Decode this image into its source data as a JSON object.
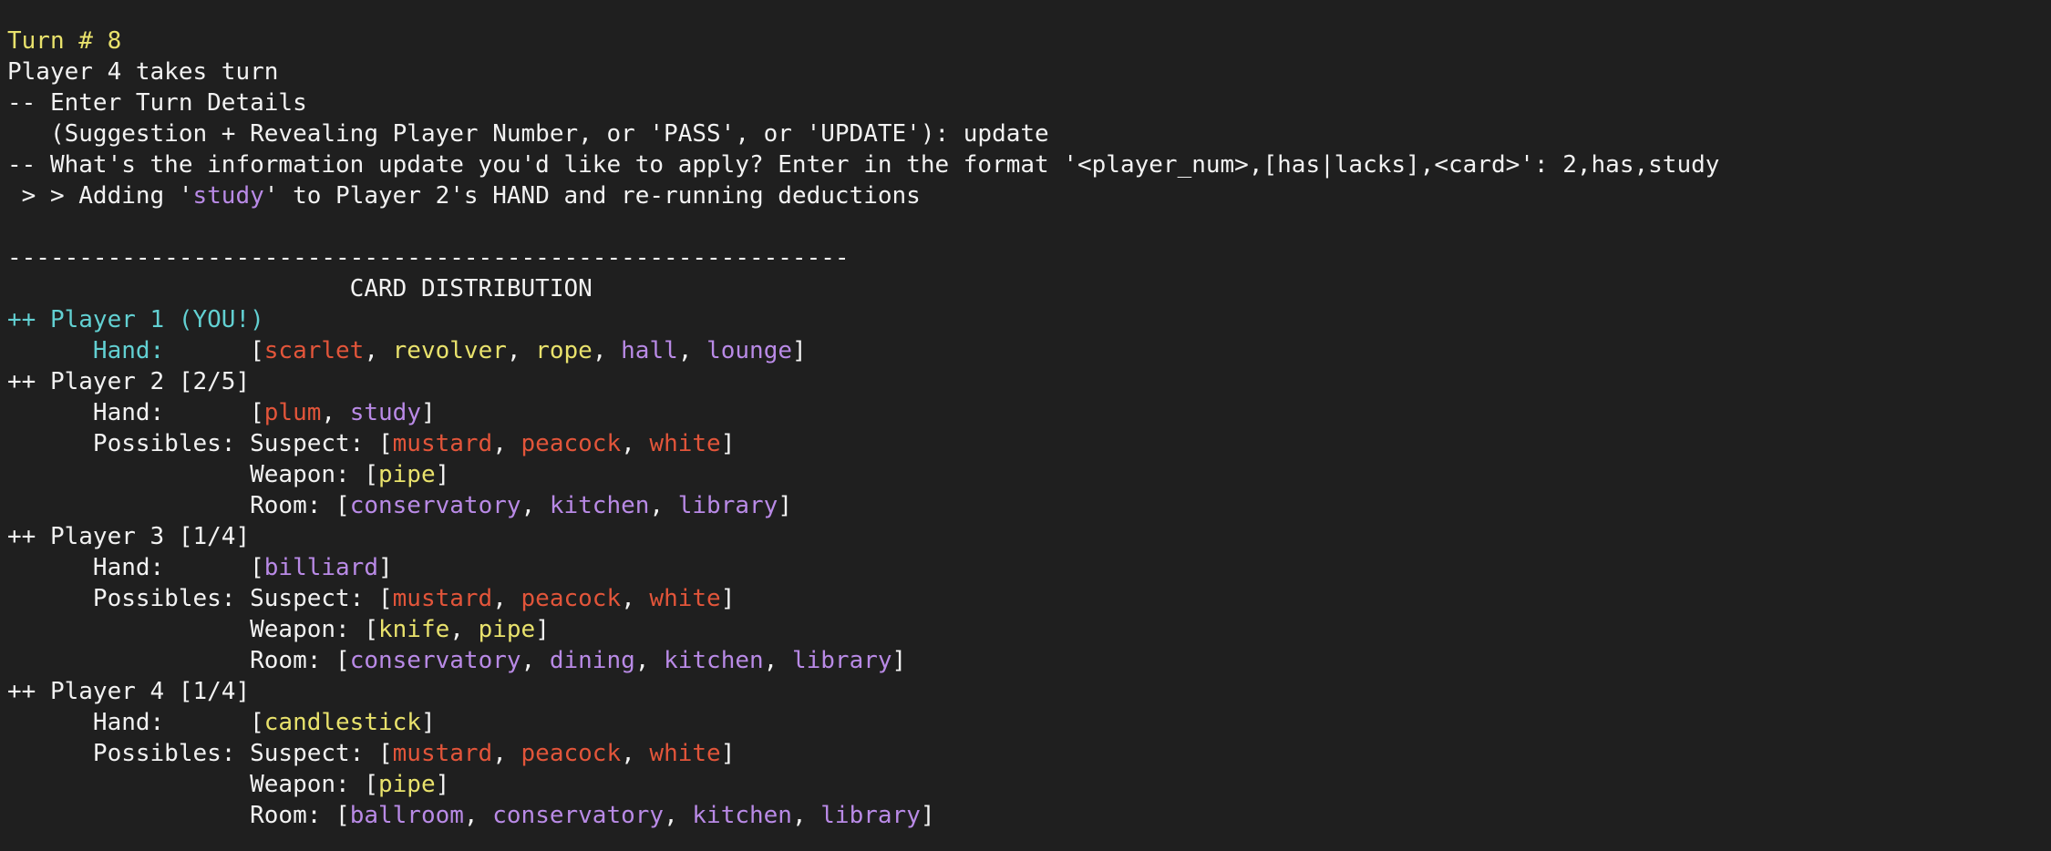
{
  "colors": {
    "background": "#1f1f1f",
    "default": "#f2f2f2",
    "turn_header": "#e9e26c",
    "you": "#62d0d2",
    "suspect": "#e2553a",
    "weapon": "#e9e26c",
    "room": "#b98ae6"
  },
  "lines": [
    {
      "name": "turn-line",
      "segs": [
        {
          "t": "Turn # 8",
          "c": "c-yellow"
        }
      ]
    },
    {
      "name": "player-turn-line",
      "segs": [
        {
          "t": "Player 4 takes turn",
          "c": "c-white"
        }
      ]
    },
    {
      "name": "enter-details-line",
      "segs": [
        {
          "t": "-- Enter Turn Details",
          "c": "c-white"
        }
      ]
    },
    {
      "name": "suggestion-prompt-line",
      "segs": [
        {
          "t": "   (Suggestion + Revealing Player Number, or 'PASS', or 'UPDATE'): update",
          "c": "c-white"
        }
      ]
    },
    {
      "name": "update-prompt-line",
      "segs": [
        {
          "t": "-- What's the information update you'd like to apply? Enter in the format '<player_num>,[has|lacks],<card>': 2,has,study",
          "c": "c-white"
        }
      ]
    },
    {
      "name": "adding-line",
      "segs": [
        {
          "t": " > > Adding '",
          "c": "c-white"
        },
        {
          "t": "study",
          "c": "c-purple"
        },
        {
          "t": "' to Player 2's HAND and re-running deductions",
          "c": "c-white"
        }
      ]
    },
    {
      "name": "blank-line",
      "segs": [
        {
          "t": "",
          "c": "c-white"
        }
      ]
    },
    {
      "name": "separator-line",
      "segs": [
        {
          "t": "-----------------------------------------------------------",
          "c": "c-white"
        }
      ]
    },
    {
      "name": "card-distribution-title",
      "segs": [
        {
          "t": "                        CARD DISTRIBUTION",
          "c": "c-white"
        }
      ]
    },
    {
      "name": "player1-header",
      "segs": [
        {
          "t": "++ Player 1 (YOU!)",
          "c": "c-cyan"
        }
      ]
    },
    {
      "name": "player1-hand",
      "segs": [
        {
          "t": "      Hand:      ",
          "c": "c-cyan"
        },
        {
          "t": "[",
          "c": "c-white"
        },
        {
          "t": "scarlet",
          "c": "c-red"
        },
        {
          "t": ", ",
          "c": "c-white"
        },
        {
          "t": "revolver",
          "c": "c-yellow"
        },
        {
          "t": ", ",
          "c": "c-white"
        },
        {
          "t": "rope",
          "c": "c-yellow"
        },
        {
          "t": ", ",
          "c": "c-white"
        },
        {
          "t": "hall",
          "c": "c-purple"
        },
        {
          "t": ", ",
          "c": "c-white"
        },
        {
          "t": "lounge",
          "c": "c-purple"
        },
        {
          "t": "]",
          "c": "c-white"
        }
      ]
    },
    {
      "name": "player2-header",
      "segs": [
        {
          "t": "++ Player 2 [2/5]",
          "c": "c-white"
        }
      ]
    },
    {
      "name": "player2-hand",
      "segs": [
        {
          "t": "      Hand:      [",
          "c": "c-white"
        },
        {
          "t": "plum",
          "c": "c-red"
        },
        {
          "t": ", ",
          "c": "c-white"
        },
        {
          "t": "study",
          "c": "c-purple"
        },
        {
          "t": "]",
          "c": "c-white"
        }
      ]
    },
    {
      "name": "player2-suspects",
      "segs": [
        {
          "t": "      Possibles: Suspect: [",
          "c": "c-white"
        },
        {
          "t": "mustard",
          "c": "c-red"
        },
        {
          "t": ", ",
          "c": "c-white"
        },
        {
          "t": "peacock",
          "c": "c-red"
        },
        {
          "t": ", ",
          "c": "c-white"
        },
        {
          "t": "white",
          "c": "c-red"
        },
        {
          "t": "]",
          "c": "c-white"
        }
      ]
    },
    {
      "name": "player2-weapons",
      "segs": [
        {
          "t": "                 Weapon: [",
          "c": "c-white"
        },
        {
          "t": "pipe",
          "c": "c-yellow"
        },
        {
          "t": "]",
          "c": "c-white"
        }
      ]
    },
    {
      "name": "player2-rooms",
      "segs": [
        {
          "t": "                 Room: [",
          "c": "c-white"
        },
        {
          "t": "conservatory",
          "c": "c-purple"
        },
        {
          "t": ", ",
          "c": "c-white"
        },
        {
          "t": "kitchen",
          "c": "c-purple"
        },
        {
          "t": ", ",
          "c": "c-white"
        },
        {
          "t": "library",
          "c": "c-purple"
        },
        {
          "t": "]",
          "c": "c-white"
        }
      ]
    },
    {
      "name": "player3-header",
      "segs": [
        {
          "t": "++ Player 3 [1/4]",
          "c": "c-white"
        }
      ]
    },
    {
      "name": "player3-hand",
      "segs": [
        {
          "t": "      Hand:      [",
          "c": "c-white"
        },
        {
          "t": "billiard",
          "c": "c-purple"
        },
        {
          "t": "]",
          "c": "c-white"
        }
      ]
    },
    {
      "name": "player3-suspects",
      "segs": [
        {
          "t": "      Possibles: Suspect: [",
          "c": "c-white"
        },
        {
          "t": "mustard",
          "c": "c-red"
        },
        {
          "t": ", ",
          "c": "c-white"
        },
        {
          "t": "peacock",
          "c": "c-red"
        },
        {
          "t": ", ",
          "c": "c-white"
        },
        {
          "t": "white",
          "c": "c-red"
        },
        {
          "t": "]",
          "c": "c-white"
        }
      ]
    },
    {
      "name": "player3-weapons",
      "segs": [
        {
          "t": "                 Weapon: [",
          "c": "c-white"
        },
        {
          "t": "knife",
          "c": "c-yellow"
        },
        {
          "t": ", ",
          "c": "c-white"
        },
        {
          "t": "pipe",
          "c": "c-yellow"
        },
        {
          "t": "]",
          "c": "c-white"
        }
      ]
    },
    {
      "name": "player3-rooms",
      "segs": [
        {
          "t": "                 Room: [",
          "c": "c-white"
        },
        {
          "t": "conservatory",
          "c": "c-purple"
        },
        {
          "t": ", ",
          "c": "c-white"
        },
        {
          "t": "dining",
          "c": "c-purple"
        },
        {
          "t": ", ",
          "c": "c-white"
        },
        {
          "t": "kitchen",
          "c": "c-purple"
        },
        {
          "t": ", ",
          "c": "c-white"
        },
        {
          "t": "library",
          "c": "c-purple"
        },
        {
          "t": "]",
          "c": "c-white"
        }
      ]
    },
    {
      "name": "player4-header",
      "segs": [
        {
          "t": "++ Player 4 [1/4]",
          "c": "c-white"
        }
      ]
    },
    {
      "name": "player4-hand",
      "segs": [
        {
          "t": "      Hand:      [",
          "c": "c-white"
        },
        {
          "t": "candlestick",
          "c": "c-yellow"
        },
        {
          "t": "]",
          "c": "c-white"
        }
      ]
    },
    {
      "name": "player4-suspects",
      "segs": [
        {
          "t": "      Possibles: Suspect: [",
          "c": "c-white"
        },
        {
          "t": "mustard",
          "c": "c-red"
        },
        {
          "t": ", ",
          "c": "c-white"
        },
        {
          "t": "peacock",
          "c": "c-red"
        },
        {
          "t": ", ",
          "c": "c-white"
        },
        {
          "t": "white",
          "c": "c-red"
        },
        {
          "t": "]",
          "c": "c-white"
        }
      ]
    },
    {
      "name": "player4-weapons",
      "segs": [
        {
          "t": "                 Weapon: [",
          "c": "c-white"
        },
        {
          "t": "pipe",
          "c": "c-yellow"
        },
        {
          "t": "]",
          "c": "c-white"
        }
      ]
    },
    {
      "name": "player4-rooms",
      "segs": [
        {
          "t": "                 Room: [",
          "c": "c-white"
        },
        {
          "t": "ballroom",
          "c": "c-purple"
        },
        {
          "t": ", ",
          "c": "c-white"
        },
        {
          "t": "conservatory",
          "c": "c-purple"
        },
        {
          "t": ", ",
          "c": "c-white"
        },
        {
          "t": "kitchen",
          "c": "c-purple"
        },
        {
          "t": ", ",
          "c": "c-white"
        },
        {
          "t": "library",
          "c": "c-purple"
        },
        {
          "t": "]",
          "c": "c-white"
        }
      ]
    }
  ]
}
